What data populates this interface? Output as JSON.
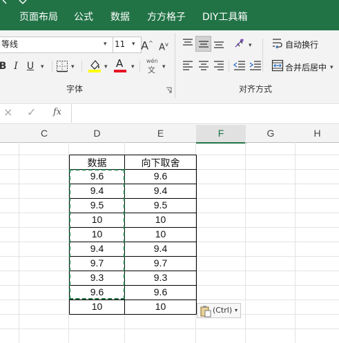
{
  "tabs": [
    "页面布局",
    "公式",
    "数据",
    "方方格子",
    "DIY工具箱"
  ],
  "font": {
    "name": "等线",
    "size": "11",
    "group_label": "字体",
    "bold": "B",
    "italic": "I",
    "underline": "U",
    "grow": "A",
    "shrink": "A",
    "phonetic_top": "wén",
    "phonetic_bottom": "文",
    "font_color_letter": "A"
  },
  "alignment": {
    "group_label": "对齐方式",
    "wrap_label": "自动换行",
    "merge_label": "合并后居中"
  },
  "formula_bar": {
    "fx": "fx",
    "cancel": "×",
    "enter": "✓"
  },
  "columns": [
    "C",
    "D",
    "E",
    "F",
    "G",
    "H"
  ],
  "table": {
    "headers": [
      "数据",
      "向下取舍"
    ],
    "rows": [
      [
        "9.6",
        "9.6"
      ],
      [
        "9.4",
        "9.4"
      ],
      [
        "9.5",
        "9.5"
      ],
      [
        "10",
        "10"
      ],
      [
        "10",
        "10"
      ],
      [
        "9.4",
        "9.4"
      ],
      [
        "9.7",
        "9.7"
      ],
      [
        "9.3",
        "9.3"
      ],
      [
        "9.6",
        "9.6"
      ],
      [
        "10",
        "10"
      ]
    ]
  },
  "paste_options": {
    "label": "(Ctrl)"
  },
  "colors": {
    "accent": "#217346",
    "highlight": "#ffff00",
    "font_color": "#e81123",
    "copy_marquee": "#217346"
  }
}
